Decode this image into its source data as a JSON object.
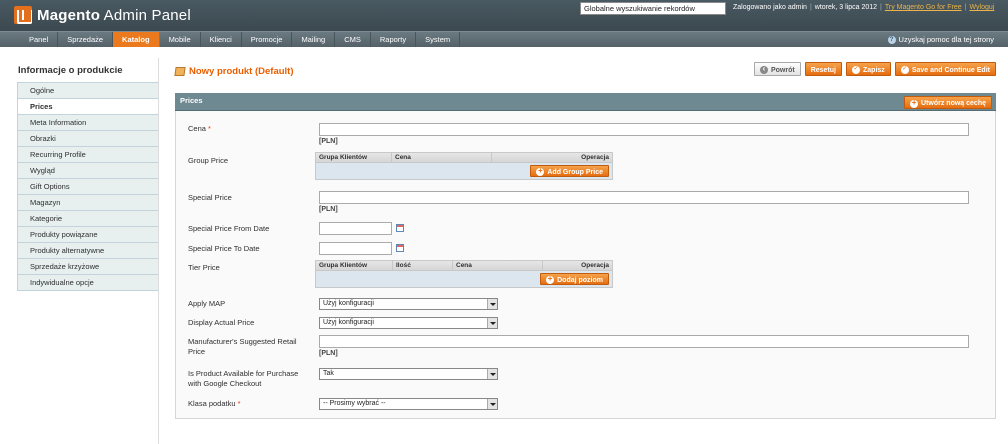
{
  "header": {
    "logo_brand": "Magento",
    "logo_suffix": "Admin Panel",
    "search_value": "Globalne wyszukiwanie rekordów",
    "logged_in": "Zalogowano jako admin",
    "date": "wtorek, 3 lipca 2012",
    "try_link": "Try Magento Go for Free",
    "logout": "Wyloguj"
  },
  "nav": {
    "items": [
      "Panel",
      "Sprzedaże",
      "Katalog",
      "Mobile",
      "Klienci",
      "Promocje",
      "Mailing",
      "CMS",
      "Raporty",
      "System"
    ],
    "active": "Katalog",
    "help": "Uzyskaj pomoc dla tej strony"
  },
  "sidebar": {
    "title": "Informacje o produkcie",
    "items": [
      "Ogólne",
      "Prices",
      "Meta Information",
      "Obrazki",
      "Recurring Profile",
      "Wygląd",
      "Gift Options",
      "Magazyn",
      "Kategorie",
      "Produkty powiązane",
      "Produkty alternatywne",
      "Sprzedaże krzyżowe",
      "Indywidualne opcje"
    ],
    "active": "Prices"
  },
  "content": {
    "title": "Nowy produkt (Default)",
    "buttons": {
      "back": "Powrót",
      "reset": "Resetuj",
      "save": "Zapisz",
      "save_continue": "Save and Continue Edit"
    }
  },
  "fieldset": {
    "title": "Prices",
    "new_attribute": "Utwórz nową cechę",
    "currency_note": "[PLN]",
    "fields": {
      "price": "Cena",
      "group_price": "Group Price",
      "special_price": "Special Price",
      "special_from": "Special Price From Date",
      "special_to": "Special Price To Date",
      "tier_price": "Tier Price",
      "apply_map": "Apply MAP",
      "display_actual": "Display Actual Price",
      "msrp": "Manufacturer's Suggested Retail Price",
      "google_checkout": "Is Product Available for Purchase with Google Checkout",
      "tax_class": "Klasa podatku"
    },
    "group_grid": {
      "headers": [
        "Grupa Klientów",
        "Cena",
        "Operacja"
      ],
      "button": "Add Group Price"
    },
    "tier_grid": {
      "headers": [
        "Grupa Klientów",
        "Ilość",
        "Cena",
        "Operacja"
      ],
      "button": "Dodaj poziom"
    },
    "selects": {
      "apply_map": "Użyj konfiguracji",
      "display_actual": "Użyj konfiguracji",
      "google_checkout": "Tak",
      "tax_class": "-- Prosimy wybrać --"
    }
  }
}
